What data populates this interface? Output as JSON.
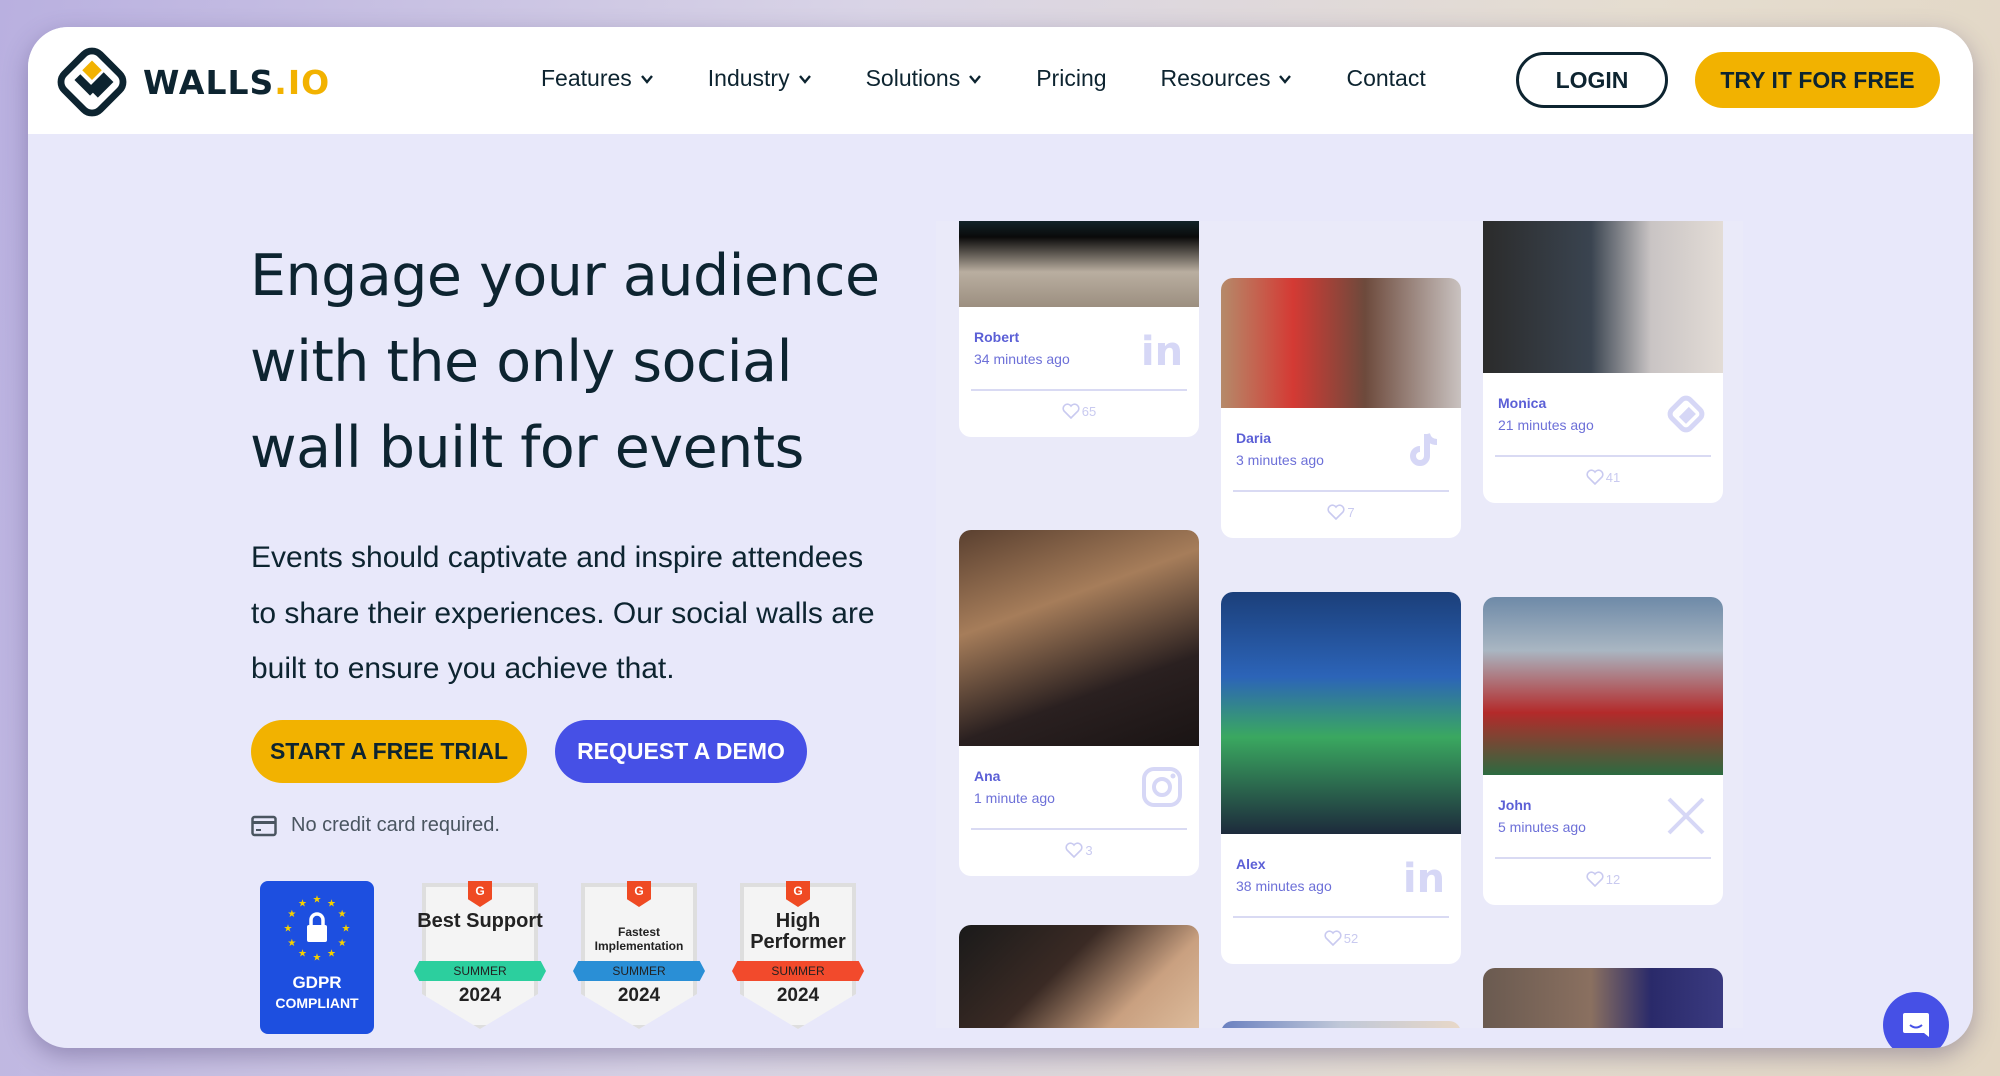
{
  "brand": {
    "name": "WALLS",
    "suffix": ".IO",
    "accent": "#f2b200",
    "dark": "#0d2430",
    "primary": "#4650e6"
  },
  "nav": {
    "items": [
      {
        "label": "Features",
        "dropdown": true
      },
      {
        "label": "Industry",
        "dropdown": true
      },
      {
        "label": "Solutions",
        "dropdown": true
      },
      {
        "label": "Pricing",
        "dropdown": false
      },
      {
        "label": "Resources",
        "dropdown": true
      },
      {
        "label": "Contact",
        "dropdown": false
      }
    ],
    "login_label": "LOGIN",
    "try_label": "TRY IT FOR FREE"
  },
  "hero": {
    "headline_lines": [
      "Engage your audience",
      "with the only social",
      "wall built for events"
    ],
    "subtext_lines": [
      "Events should captivate and inspire attendees",
      "to share their experiences. Our social walls are",
      "built to ensure you achieve that."
    ],
    "cta_trial": "START A FREE TRIAL",
    "cta_demo": "REQUEST A DEMO",
    "no_card_icon": "credit-card-icon",
    "no_card": "No credit card required."
  },
  "badges": {
    "gdpr": {
      "line1": "GDPR",
      "line2": "COMPLIANT"
    },
    "g2": [
      {
        "title": "Best Support",
        "size": "big",
        "season": "SUMMER",
        "year": "2024",
        "ribbon_color": "#2ccf9e"
      },
      {
        "title": "Fastest Implementation",
        "size": "small",
        "season": "SUMMER",
        "year": "2024",
        "ribbon_color": "#2a8fd6"
      },
      {
        "title": "High Performer",
        "size": "big",
        "season": "SUMMER",
        "year": "2024",
        "ribbon_color": "#f24a2c"
      }
    ]
  },
  "wall": {
    "posts": [
      {
        "author": "Robert",
        "time": "34 minutes ago",
        "network": "linkedin-icon",
        "likes": "65"
      },
      {
        "author": "Daria",
        "time": "3 minutes ago",
        "network": "tiktok-icon",
        "likes": "7"
      },
      {
        "author": "Monica",
        "time": "21 minutes ago",
        "network": "wallsio-icon",
        "likes": "41"
      },
      {
        "author": "Ana",
        "time": "1 minute ago",
        "network": "instagram-icon",
        "likes": "3"
      },
      {
        "author": "Alex",
        "time": "38 minutes ago",
        "network": "linkedin-icon",
        "likes": "52"
      },
      {
        "author": "John",
        "time": "5 minutes ago",
        "network": "x-icon",
        "likes": "12"
      }
    ]
  },
  "chat": {
    "icon": "chat-icon"
  }
}
